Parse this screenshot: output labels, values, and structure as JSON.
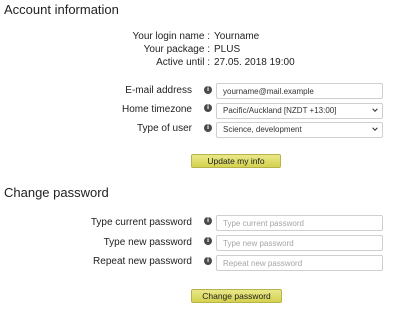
{
  "account": {
    "title": "Account information",
    "login_label": "Your login name :",
    "login_value": "Yourname",
    "package_label": "Your package :",
    "package_value": "PLUS",
    "active_label": "Active until :",
    "active_value": "27.05. 2018 19:00",
    "email_label": "E-mail address",
    "email_value": "yourname@mail.example",
    "timezone_label": "Home timezone",
    "timezone_value": "Pacific/Auckland [NZDT +13:00]",
    "usertype_label": "Type of user",
    "usertype_value": "Science, development",
    "update_button": "Update my info"
  },
  "password": {
    "title": "Change password",
    "current_label": "Type current password",
    "current_placeholder": "Type current password",
    "new_label": "Type new password",
    "new_placeholder": "Type new password",
    "repeat_label": "Repeat new password",
    "repeat_placeholder": "Repeat new password",
    "change_button": "Change password"
  },
  "icons": {
    "info": "info-icon",
    "dropdown": "chevron-down-icon"
  },
  "colors": {
    "button": "#dedb6a",
    "border": "#cfcfcf"
  }
}
